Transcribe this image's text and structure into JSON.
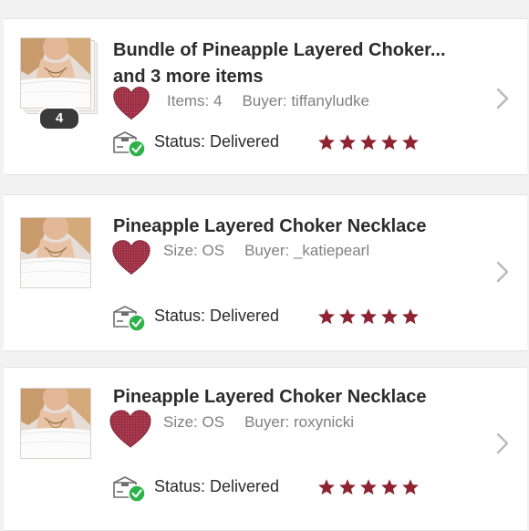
{
  "colors": {
    "heart": "#9c2c41",
    "star": "#8e2431",
    "badge": "#3a3a3a",
    "check": "#2db24a"
  },
  "orders": [
    {
      "title_line1": "Bundle of Pineapple Layered Choker...",
      "title_line2": "and 3 more items",
      "meta_label": "Items: 4",
      "buyer": "Buyer: tiffanyludke",
      "bundle_count": "4",
      "status": "Status:  Delivered",
      "rating": 5,
      "icons": [
        "heart-icon",
        "package-delivered-icon",
        "chevron-right-icon"
      ]
    },
    {
      "title_line1": "Pineapple Layered Choker Necklace",
      "meta_label": "Size: OS",
      "buyer": "Buyer: _katiepearl",
      "status": "Status:  Delivered",
      "rating": 5,
      "icons": [
        "heart-icon",
        "package-delivered-icon",
        "chevron-right-icon"
      ]
    },
    {
      "title_line1": "Pineapple Layered Choker Necklace",
      "meta_label": "Size: OS",
      "buyer": "Buyer: roxynicki",
      "status": "Status:  Delivered",
      "rating": 5,
      "icons": [
        "heart-icon",
        "package-delivered-icon",
        "chevron-right-icon"
      ]
    }
  ]
}
